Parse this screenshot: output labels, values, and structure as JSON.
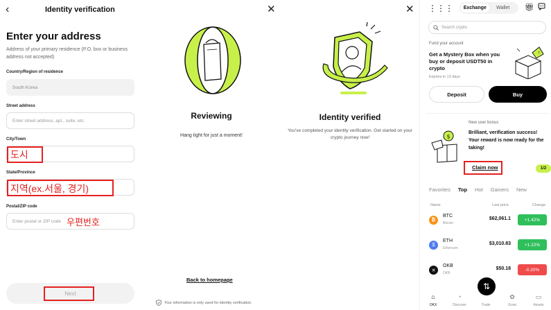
{
  "address_form": {
    "title": "Identity verification",
    "heading": "Enter your address",
    "subtext": "Address of your primary residence (P.O. box or business address not accepted)",
    "country_label": "Country/Region of residence",
    "country_value": "South Korea",
    "street_label": "Street address",
    "street_placeholder": "Enter street address, apt., suite, etc.",
    "city_label": "City/Town",
    "city_annotation": "도시",
    "state_label": "State/Province",
    "state_annotation": "지역(ex.서울, 경기)",
    "postal_label": "Postal/ZIP code",
    "postal_placeholder": "Enter postal or ZIP code",
    "postal_annotation": "우편번호",
    "next_label": "Next",
    "back_icon": "‹"
  },
  "reviewing": {
    "title": "Reviewing",
    "subtitle": "Hang tight for just a moment!",
    "close_icon": "✕",
    "home_link": "Back to homepage",
    "privacy_note": "Your information is only used for identity verification."
  },
  "verified": {
    "title": "Identity verified",
    "subtitle": "You've completed your identity verification. Get started on your crypto journey now!",
    "close_icon": "✕"
  },
  "home": {
    "segment": [
      "Exchange",
      "Wallet"
    ],
    "search_placeholder": "Search crypto",
    "fund_label": "Fund your account",
    "fund_title": "Get a Mystery Box when you buy or deposit USDT50 in crypto",
    "fund_expiry": "Expires in 13 days",
    "deposit_label": "Deposit",
    "buy_label": "Buy",
    "bonus_label": "New user bonus",
    "bonus_text": "Brilliant, verification success! Your reward is now ready for the taking!",
    "claim_label": "Claim now",
    "pager": "1/2",
    "tabs": [
      "Favorites",
      "Top",
      "Hot",
      "Gainers",
      "New"
    ],
    "col_name": "Name",
    "col_price": "Last price",
    "col_change": "Change",
    "rows": [
      {
        "symbol": "BTC",
        "name": "Bitcoin",
        "price": "$62,061.1",
        "change": "+1.42%",
        "coin": "₿",
        "color": "#f7931a",
        "chg_color": "#2fbf5b"
      },
      {
        "symbol": "ETH",
        "name": "Ethereum",
        "price": "$3,010.83",
        "change": "+1.22%",
        "coin": "Ξ",
        "color": "#4f7cf0",
        "chg_color": "#2fbf5b"
      },
      {
        "symbol": "OKB",
        "name": "OKB",
        "price": "$50.18",
        "change": "-0.20%",
        "coin": "✕",
        "color": "#111111",
        "chg_color": "#ef4b4b"
      }
    ],
    "nav": [
      {
        "label": "OKX",
        "icon": "⌂"
      },
      {
        "label": "Discover",
        "icon": "◔"
      },
      {
        "label": "Trade",
        "icon": ""
      },
      {
        "label": "Grow",
        "icon": "✿"
      },
      {
        "label": "Assets",
        "icon": "▭"
      }
    ],
    "trade_icon": "⇅"
  },
  "accent_colors": {
    "highlight": "#e52020",
    "lime": "#c8f04a"
  }
}
